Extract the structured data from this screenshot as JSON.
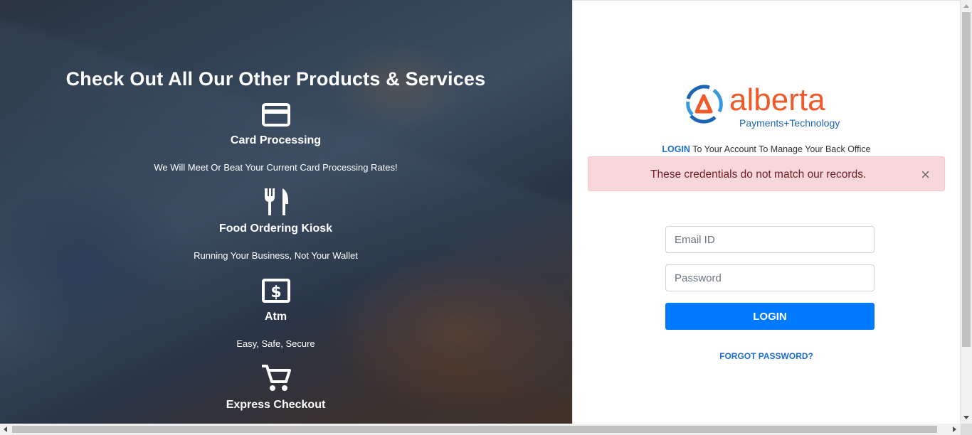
{
  "hero": {
    "title": "Check Out All Our Other Products & Services",
    "services": [
      {
        "name": "Card Processing",
        "desc": "We Will Meet Or Beat Your Current Card Processing Rates!",
        "icon": "credit-card-icon"
      },
      {
        "name": "Food Ordering Kiosk",
        "desc": "Running Your Business, Not Your Wallet",
        "icon": "utensils-icon"
      },
      {
        "name": "Atm",
        "desc": "Easy, Safe, Secure",
        "icon": "dollar-bill-icon"
      },
      {
        "name": "Express Checkout",
        "icon": "shopping-cart-icon"
      }
    ]
  },
  "login": {
    "logo_word": "alberta",
    "logo_sub": "Payments+Technology",
    "tagline_login": "LOGIN",
    "tagline_rest": " To Your Account To Manage Your Back Office",
    "alert": "These credentials do not match our records.",
    "alert_close": "×",
    "email_placeholder": "Email ID",
    "password_placeholder": "Password",
    "button": "LOGIN",
    "forgot": "FORGOT PASSWORD?"
  },
  "colors": {
    "primary": "#007bff",
    "link": "#1b6fd1",
    "alert_bg": "#f8d7da",
    "alert_text": "#721c24",
    "logo_orange": "#f05a28",
    "logo_blue": "#1e64b4"
  }
}
